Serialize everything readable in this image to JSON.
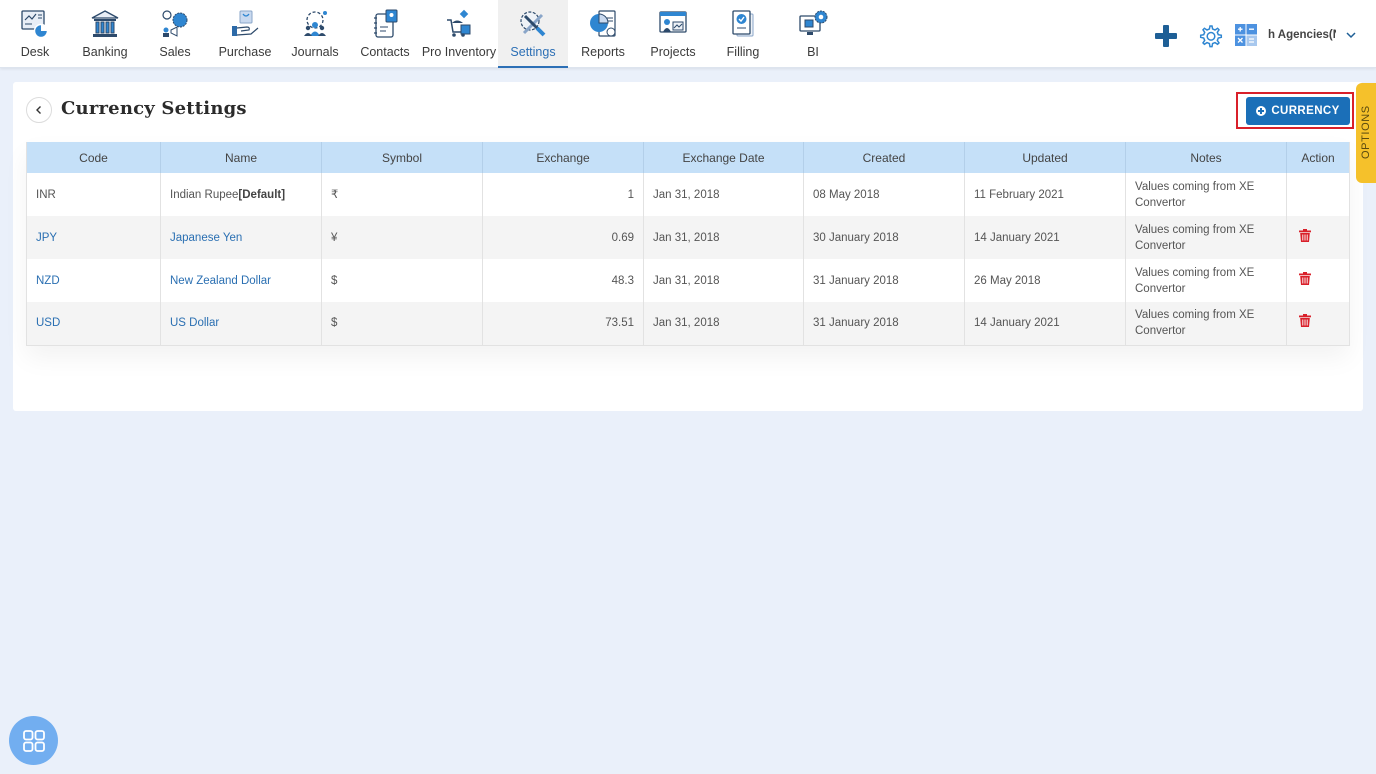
{
  "nav": {
    "items": [
      {
        "label": "Desk",
        "icon": "desk-icon"
      },
      {
        "label": "Banking",
        "icon": "bank-icon"
      },
      {
        "label": "Sales",
        "icon": "sales-icon"
      },
      {
        "label": "Purchase",
        "icon": "purchase-icon"
      },
      {
        "label": "Journals",
        "icon": "journals-icon"
      },
      {
        "label": "Contacts",
        "icon": "contacts-icon"
      },
      {
        "label": "Pro Inventory",
        "icon": "inventory-icon"
      },
      {
        "label": "Settings",
        "icon": "settings-icon",
        "active": true
      },
      {
        "label": "Reports",
        "icon": "reports-icon"
      },
      {
        "label": "Projects",
        "icon": "projects-icon"
      },
      {
        "label": "Filling",
        "icon": "filling-icon"
      },
      {
        "label": "BI",
        "icon": "bi-icon"
      }
    ]
  },
  "header_right": {
    "company": "h Agencies(N",
    "icons": [
      "plus-icon",
      "gear-icon",
      "calculator-icon",
      "chevron-down-icon"
    ]
  },
  "page": {
    "title": "Currency Settings",
    "add_button": "CURRENCY",
    "options_tab": "OPTIONS"
  },
  "table": {
    "columns": [
      "Code",
      "Name",
      "Symbol",
      "Exchange",
      "Exchange Date",
      "Created",
      "Updated",
      "Notes",
      "Action"
    ],
    "rows": [
      {
        "code": "INR",
        "name": "Indian Rupee",
        "default_tag": "[Default]",
        "symbol": "₹",
        "exchange": "1",
        "exchange_date": "Jan 31, 2018",
        "created": "08 May 2018",
        "updated": "11 February 2021",
        "notes": "Values coming from XE Convertor",
        "deletable": false
      },
      {
        "code": "JPY",
        "name": "Japanese Yen",
        "default_tag": "",
        "symbol": "¥",
        "exchange": "0.69",
        "exchange_date": "Jan 31, 2018",
        "created": "30 January 2018",
        "updated": "14 January 2021",
        "notes": "Values coming from XE Convertor",
        "deletable": true
      },
      {
        "code": "NZD",
        "name": "New Zealand Dollar",
        "default_tag": "",
        "symbol": "$",
        "exchange": "48.3",
        "exchange_date": "Jan 31, 2018",
        "created": "31 January 2018",
        "updated": "26 May 2018",
        "notes": "Values coming from XE Convertor",
        "deletable": true
      },
      {
        "code": "USD",
        "name": "US Dollar",
        "default_tag": "",
        "symbol": "$",
        "exchange": "73.51",
        "exchange_date": "Jan 31, 2018",
        "created": "31 January 2018",
        "updated": "14 January 2021",
        "notes": "Values coming from XE Convertor",
        "deletable": true
      }
    ]
  },
  "colors": {
    "accent": "#1b6fb8",
    "link": "#2a6fb2",
    "table_header": "#c5e0f8",
    "delete": "#d9202a",
    "options_tab": "#f5c12b",
    "highlight_border": "#d9202a"
  }
}
